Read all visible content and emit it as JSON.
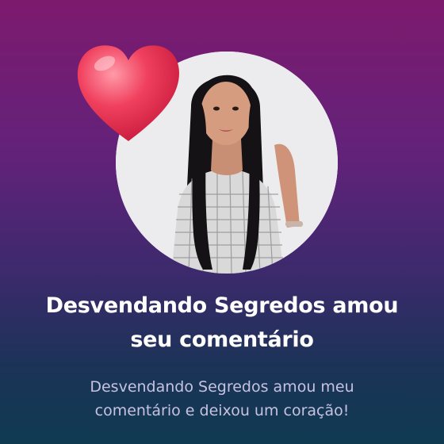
{
  "notification": {
    "title_line1": "Desvendando Segredos amou",
    "title_line2": "seu comentário",
    "subtitle_line1": "Desvendando Segredos amou meu",
    "subtitle_line2": "comentário e deixou um coração!"
  },
  "icons": {
    "heart": "heart-icon"
  },
  "colors": {
    "gradient_top": "#7d1a6e",
    "gradient_bottom": "#0f3a52",
    "heart": "#f0405e",
    "title": "#ffffff",
    "subtitle": "#c7c2e1"
  }
}
